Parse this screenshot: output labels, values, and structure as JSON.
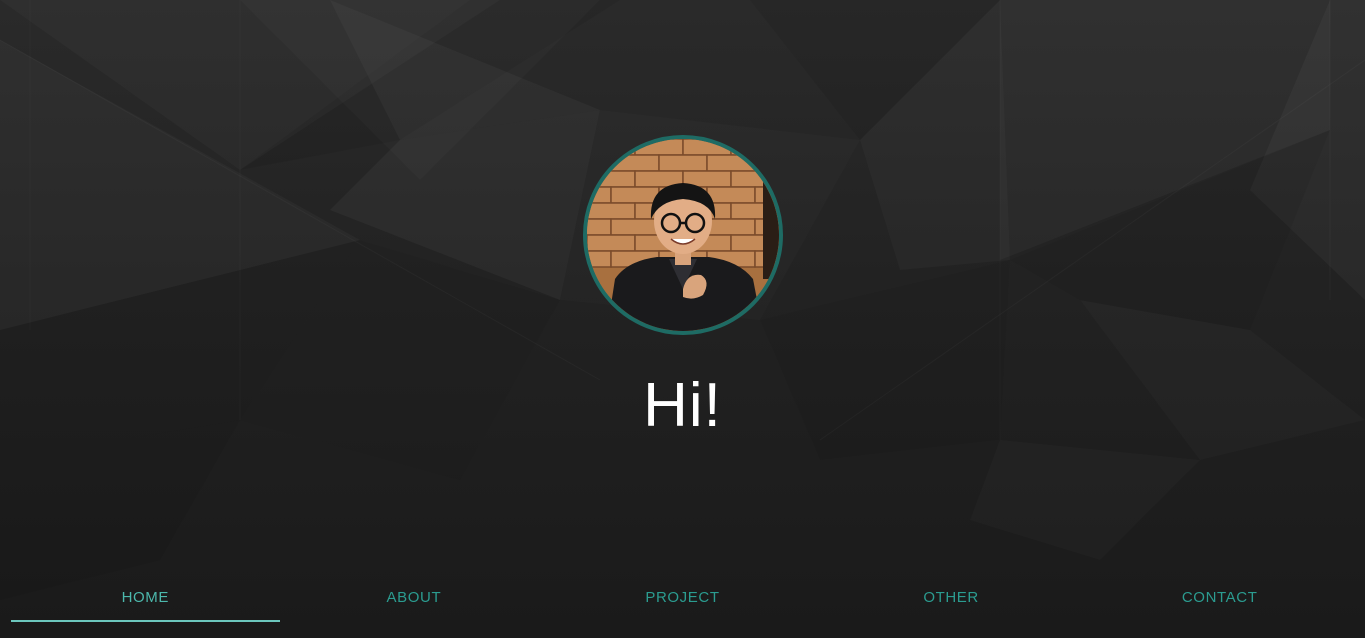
{
  "hero": {
    "greeting": "Hi!",
    "avatar_icon": "profile-photo"
  },
  "nav": {
    "items": [
      {
        "label": "HOME",
        "active": true
      },
      {
        "label": "ABOUT",
        "active": false
      },
      {
        "label": "PROJECT",
        "active": false
      },
      {
        "label": "OTHER",
        "active": false
      },
      {
        "label": "CONTACT",
        "active": false
      }
    ]
  },
  "colors": {
    "background": "#1c1c1c",
    "accent": "#2b9c90",
    "accent_light": "#6cc7bd",
    "avatar_border": "#1e6b64",
    "heading": "#ffffff"
  }
}
